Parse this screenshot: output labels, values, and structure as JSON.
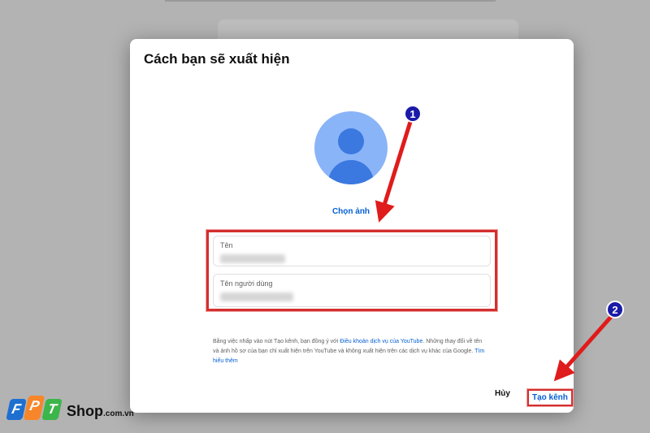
{
  "dialog": {
    "title": "Cách bạn sẽ xuất hiện",
    "choose_photo": "Chọn ảnh",
    "fields": [
      {
        "label": "Tên",
        "value": ""
      },
      {
        "label": "Tên người dùng",
        "value": ""
      }
    ],
    "terms": {
      "part1": "Bằng việc nhấp vào nút Tạo kênh, bạn đồng ý với ",
      "link1": "Điều khoản dịch vụ của YouTube",
      "part2": ". Những thay đổi về tên và ảnh hồ sơ của bạn chỉ xuất hiện trên YouTube và không xuất hiện trên các dịch vụ khác của Google. ",
      "link2": "Tìm hiểu thêm"
    },
    "cancel_label": "Hủy",
    "create_label": "Tạo kênh"
  },
  "annotations": {
    "step1": "1",
    "step2": "2",
    "accent": "#d32f2f"
  },
  "watermark": {
    "letters": [
      "F",
      "P",
      "T"
    ],
    "shop": "Shop",
    "domain": ".com.vn",
    "colors": [
      "#1e6fd0",
      "#f7862a",
      "#3cb54a"
    ]
  }
}
